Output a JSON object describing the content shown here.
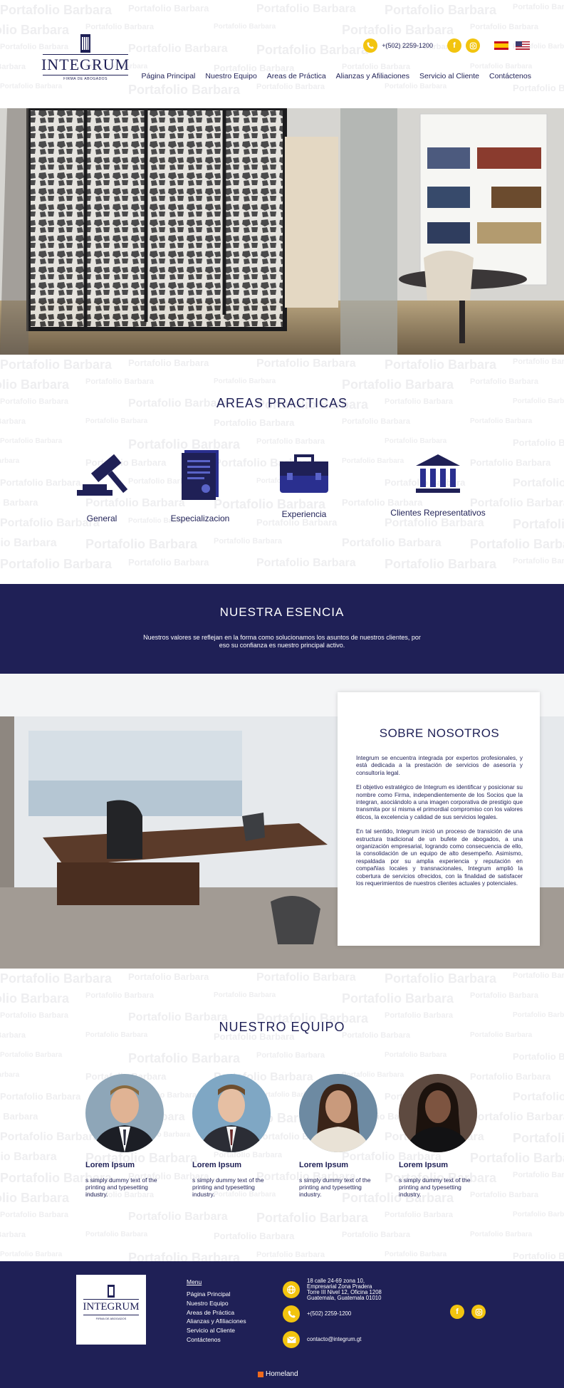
{
  "watermark": "Portafolio Barbara",
  "header": {
    "logo_name": "INTEGRUM",
    "logo_sub": "FIRMA DE ABOGADOS",
    "phone": "+(502) 2259-1200",
    "nav": [
      "Página Principal",
      "Nuestro Equipo",
      "Areas de Práctica",
      "Alianzas y Afiliaciones",
      "Servicio al Cliente",
      "Contáctenos"
    ]
  },
  "areas": {
    "title": "AREAS PRACTICAS",
    "items": [
      "General",
      "Especializacion",
      "Experiencia",
      "Clientes Representativos"
    ]
  },
  "esencia": {
    "title": "NUESTRA ESENCIA",
    "text": "Nuestros valores se reflejan en la forma como solucionamos los asuntos de nuestros clientes, por eso su confianza es nuestro principal activo."
  },
  "sobre": {
    "title": "SOBRE NOSOTROS",
    "paragraphs": [
      "Integrum se encuentra integrada por expertos profesionales, y está dedicada a la prestación de servicios de asesoría y consultoría legal.",
      "El objetivo estratégico de Integrum es identificar y posicionar su nombre como Firma, independientemente de los Socios que la integran, asociándolo a una imagen corporativa de prestigio que transmita por sí misma el primordial compromiso con los valores éticos, la excelencia y calidad de sus servicios legales.",
      "En tal sentido, Integrum inició un proceso de transición de una estructura tradicional de un bufete de abogados, a una organización empresarial, logrando como consecuencia de ello, la consolidación de un equipo de alto desempeño. Asimismo, respaldada por su amplia experiencia y reputación en compañías locales y transnacionales, Integrum amplió la cobertura de servicios ofrecidos, con la finalidad de satisfacer los requerimientos de nuestros clientes actuales y potenciales."
    ]
  },
  "equipo": {
    "title": "NUESTRO EQUIPO",
    "members": [
      {
        "name": "Lorem Ipsum",
        "desc": "s simply dummy text of the printing and typesetting industry."
      },
      {
        "name": "Lorem Ipsum",
        "desc": "s simply dummy text of the printing and typesetting industry."
      },
      {
        "name": "Lorem Ipsum",
        "desc": "s simply dummy text of the printing and typesetting industry."
      },
      {
        "name": "Lorem Ipsum",
        "desc": "s simply dummy text of the printing and typesetting industry."
      }
    ]
  },
  "footer": {
    "logo_name": "INTEGRUM",
    "logo_sub": "FIRMA DE ABOGADOS",
    "menu_title": "Menu",
    "menu": [
      "Página Principal",
      "Nuestro Equipo",
      "Areas de Práctica",
      "Alianzas y Afiliaciones",
      "Servicio al Cliente",
      "Contáctenos"
    ],
    "address": [
      "18 calle 24-69 zona 10,",
      "Empresarial Zona Pradera",
      "Torre III Nivel 12, Oficina 1208",
      "Guatemala, Guatemala 01010"
    ],
    "phone": "+(502) 2259-1200",
    "email": "contacto@integrum.gt",
    "brand": "Homeland"
  },
  "colors": {
    "navy": "#1f2056",
    "accent": "#f2c40f"
  }
}
